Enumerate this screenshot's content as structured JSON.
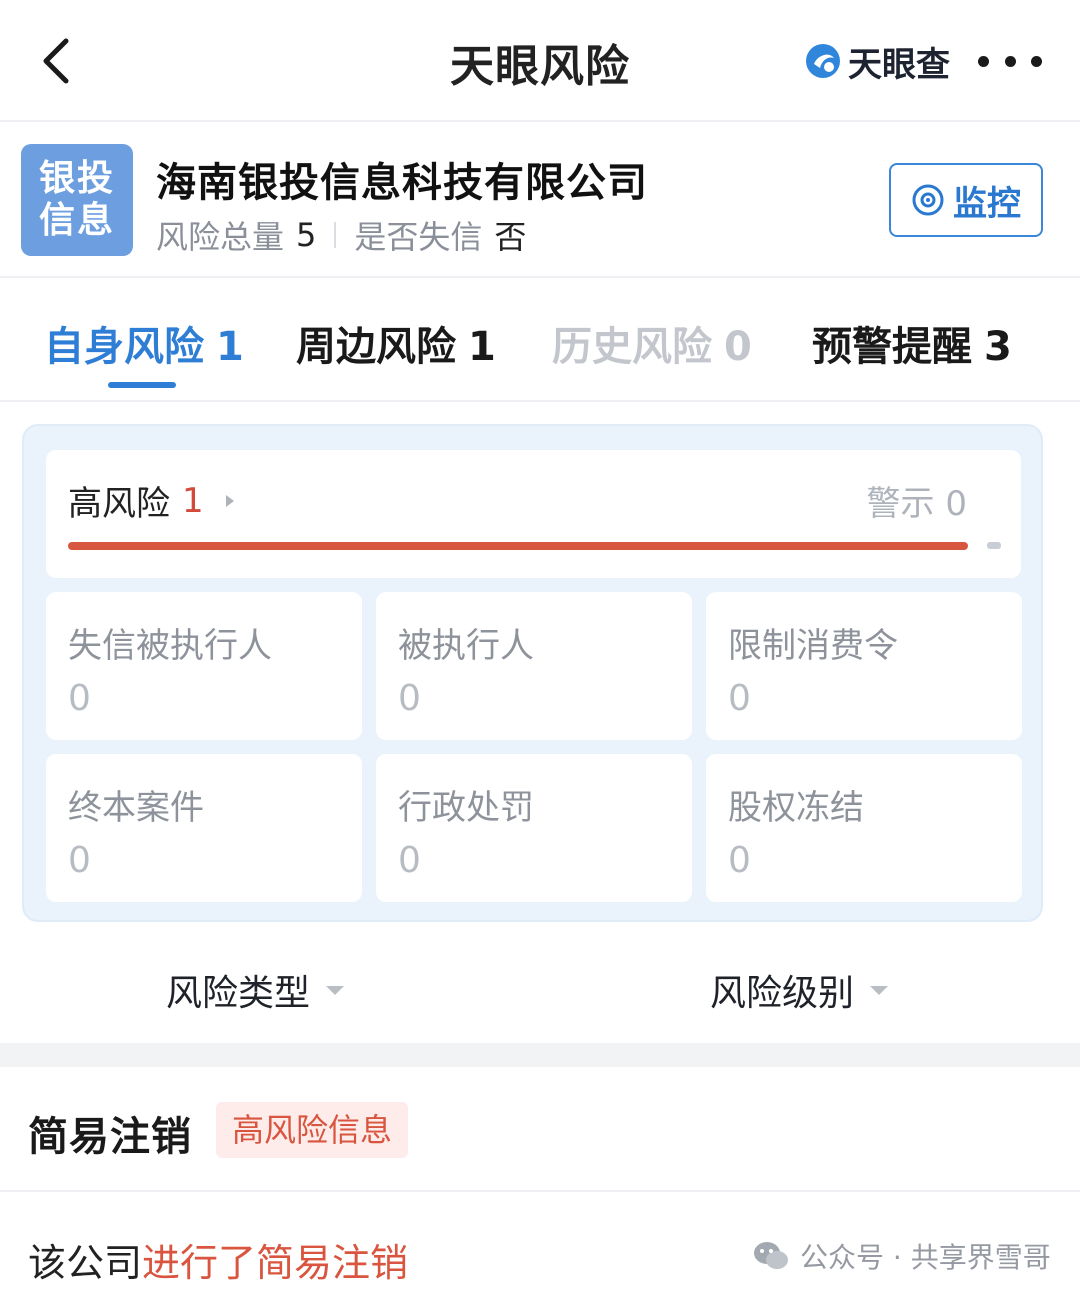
{
  "navbar": {
    "title": "天眼风险",
    "brand": "天眼查",
    "back_icon": "chevron-left-icon",
    "more_icon": "more-dots-icon"
  },
  "company": {
    "logo_line1": "银投",
    "logo_line2": "信息",
    "name": "海南银投信息科技有限公司",
    "risk_total_label": "风险总量",
    "risk_total_value": "5",
    "dishonest_label": "是否失信",
    "dishonest_value": "否",
    "monitor_label": "监控"
  },
  "tabs": [
    {
      "label": "自身风险",
      "count": "1",
      "active": true
    },
    {
      "label": "周边风险",
      "count": "1"
    },
    {
      "label": "历史风险",
      "count": "0",
      "disabled": true
    },
    {
      "label": "预警提醒",
      "count": "3"
    }
  ],
  "panel": {
    "high_risk_label": "高风险",
    "high_risk_count": "1",
    "warning_label": "警示",
    "warning_count": "0",
    "high_risk_fraction": 1.0,
    "cells": [
      {
        "name": "失信被执行人",
        "value": "0"
      },
      {
        "name": "被执行人",
        "value": "0"
      },
      {
        "name": "限制消费令",
        "value": "0"
      },
      {
        "name": "终本案件",
        "value": "0"
      },
      {
        "name": "行政处罚",
        "value": "0"
      },
      {
        "name": "股权冻结",
        "value": "0"
      }
    ]
  },
  "filters": {
    "type_label": "风险类型",
    "level_label": "风险级别"
  },
  "record": {
    "title": "简易注销",
    "tag": "高风险信息",
    "body_prefix": "该公司",
    "body_highlight": "进行了简易注销"
  },
  "watermark": {
    "text": "公众号 · 共享界雪哥"
  },
  "colors": {
    "accent_blue": "#2f7ed6",
    "risk_red": "#d8553f",
    "muted_gray": "#8e939b"
  }
}
